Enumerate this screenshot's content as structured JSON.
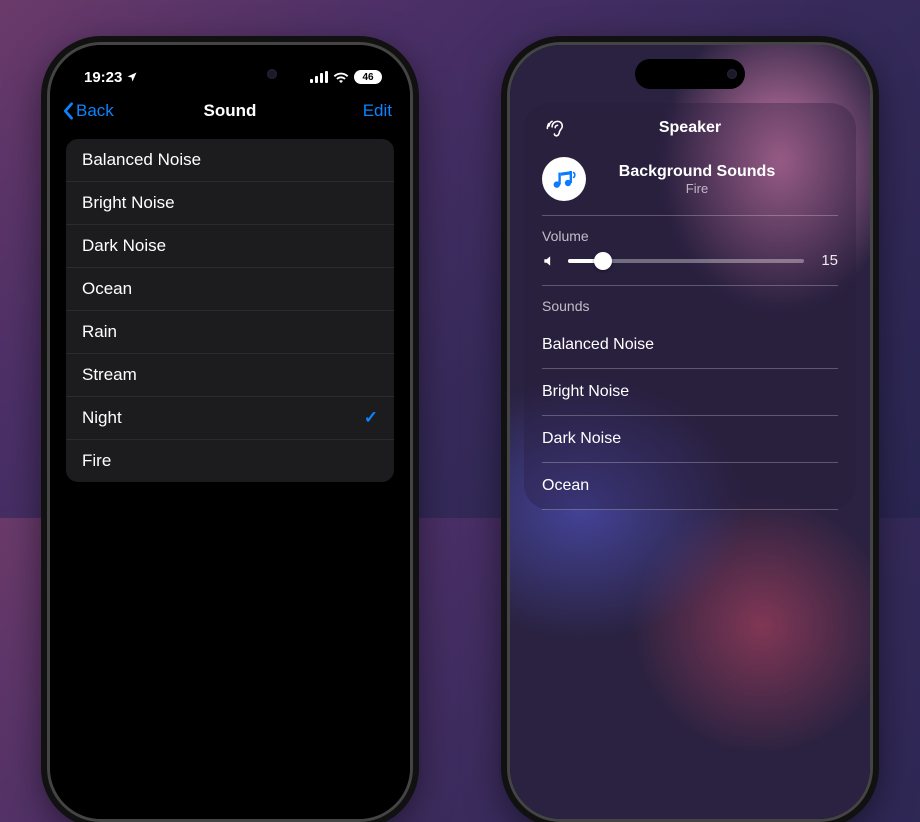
{
  "left": {
    "status": {
      "time": "19:23",
      "battery": "46"
    },
    "nav": {
      "back": "Back",
      "title": "Sound",
      "edit": "Edit"
    },
    "sounds": [
      {
        "label": "Balanced Noise",
        "selected": false
      },
      {
        "label": "Bright Noise",
        "selected": false
      },
      {
        "label": "Dark Noise",
        "selected": false
      },
      {
        "label": "Ocean",
        "selected": false
      },
      {
        "label": "Rain",
        "selected": false
      },
      {
        "label": "Stream",
        "selected": false
      },
      {
        "label": "Night",
        "selected": true
      },
      {
        "label": "Fire",
        "selected": false
      }
    ],
    "checkmark_glyph": "✓"
  },
  "right": {
    "header": "Speaker",
    "now_playing": {
      "title": "Background Sounds",
      "subtitle": "Fire"
    },
    "volume": {
      "label": "Volume",
      "value": 15,
      "max": 100
    },
    "sounds_label": "Sounds",
    "sounds": [
      {
        "label": "Balanced Noise"
      },
      {
        "label": "Bright Noise"
      },
      {
        "label": "Dark Noise"
      },
      {
        "label": "Ocean"
      }
    ]
  }
}
